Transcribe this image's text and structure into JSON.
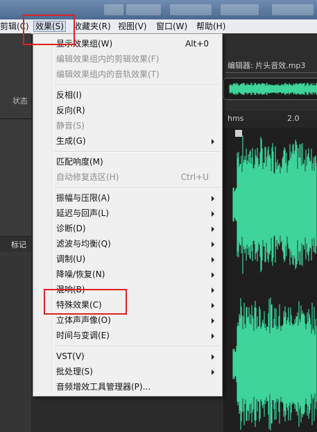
{
  "menubar": {
    "items": [
      {
        "label": "剪辑(C)"
      },
      {
        "label": "效果(S)"
      },
      {
        "label": "收藏夹(R)"
      },
      {
        "label": "视图(V)"
      },
      {
        "label": "窗口(W)"
      },
      {
        "label": "帮助(H)"
      }
    ],
    "active_item": "效果(S)"
  },
  "left_panel": {
    "status_label": "状态",
    "tab_label": "标记"
  },
  "editor": {
    "title": "编辑器: 片头音效.mp3",
    "ruler": {
      "unit_label": "hms",
      "tick_label": "2.0"
    }
  },
  "effects_menu": {
    "items": [
      {
        "label": "显示效果组(W)",
        "shortcut": "Alt+0",
        "disabled": false,
        "submenu": false
      },
      {
        "label": "编辑效果组内的剪辑效果(F)",
        "shortcut": "",
        "disabled": true,
        "submenu": false
      },
      {
        "label": "编辑效果组内的音轨效果(T)",
        "shortcut": "",
        "disabled": true,
        "submenu": false
      },
      {
        "label": "反相(I)",
        "shortcut": "",
        "disabled": false,
        "submenu": false
      },
      {
        "label": "反向(R)",
        "shortcut": "",
        "disabled": false,
        "submenu": false
      },
      {
        "label": "静音(S)",
        "shortcut": "",
        "disabled": true,
        "submenu": false
      },
      {
        "label": "生成(G)",
        "shortcut": "",
        "disabled": false,
        "submenu": true
      },
      {
        "label": "匹配响度(M)",
        "shortcut": "",
        "disabled": false,
        "submenu": false
      },
      {
        "label": "自动修复选区(H)",
        "shortcut": "Ctrl+U",
        "disabled": true,
        "submenu": false
      },
      {
        "label": "振幅与压限(A)",
        "shortcut": "",
        "disabled": false,
        "submenu": true
      },
      {
        "label": "延迟与回声(L)",
        "shortcut": "",
        "disabled": false,
        "submenu": true
      },
      {
        "label": "诊断(D)",
        "shortcut": "",
        "disabled": false,
        "submenu": true
      },
      {
        "label": "滤波与均衡(Q)",
        "shortcut": "",
        "disabled": false,
        "submenu": true
      },
      {
        "label": "调制(U)",
        "shortcut": "",
        "disabled": false,
        "submenu": true
      },
      {
        "label": "降噪/恢复(N)",
        "shortcut": "",
        "disabled": false,
        "submenu": true
      },
      {
        "label": "混响(B)",
        "shortcut": "",
        "disabled": false,
        "submenu": true
      },
      {
        "label": "特殊效果(C)",
        "shortcut": "",
        "disabled": false,
        "submenu": true
      },
      {
        "label": "立体声声像(O)",
        "shortcut": "",
        "disabled": false,
        "submenu": true
      },
      {
        "label": "时间与变调(E)",
        "shortcut": "",
        "disabled": false,
        "submenu": true
      },
      {
        "label": "VST(V)",
        "shortcut": "",
        "disabled": false,
        "submenu": true
      },
      {
        "label": "批处理(S)",
        "shortcut": "",
        "disabled": false,
        "submenu": true
      },
      {
        "label": "音频增效工具管理器(P)...",
        "shortcut": "",
        "disabled": false,
        "submenu": false
      }
    ]
  },
  "colors": {
    "waveform": "#3ed49a",
    "highlight_box": "#e02020",
    "menu_background": "#f0f0f0"
  }
}
